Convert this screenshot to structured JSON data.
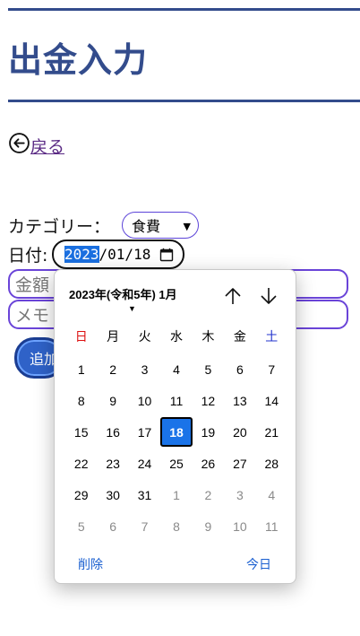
{
  "page": {
    "title": "出金入力"
  },
  "nav": {
    "back_label": "戻る"
  },
  "form": {
    "category_label": "カテゴリー：",
    "category_value": "食費",
    "date_label": "日付:",
    "date_year": "2023",
    "date_rest": "/01/18",
    "amount_placeholder": "金額",
    "memo_placeholder": "メモ",
    "add_label": "追加"
  },
  "datepicker": {
    "month_label": "2023年(令和5年) 1月",
    "weekdays": [
      "日",
      "月",
      "火",
      "水",
      "木",
      "金",
      "土"
    ],
    "days": [
      {
        "d": "1",
        "m": "cur"
      },
      {
        "d": "2",
        "m": "cur"
      },
      {
        "d": "3",
        "m": "cur"
      },
      {
        "d": "4",
        "m": "cur"
      },
      {
        "d": "5",
        "m": "cur"
      },
      {
        "d": "6",
        "m": "cur"
      },
      {
        "d": "7",
        "m": "cur"
      },
      {
        "d": "8",
        "m": "cur"
      },
      {
        "d": "9",
        "m": "cur"
      },
      {
        "d": "10",
        "m": "cur"
      },
      {
        "d": "11",
        "m": "cur"
      },
      {
        "d": "12",
        "m": "cur"
      },
      {
        "d": "13",
        "m": "cur"
      },
      {
        "d": "14",
        "m": "cur"
      },
      {
        "d": "15",
        "m": "cur"
      },
      {
        "d": "16",
        "m": "cur"
      },
      {
        "d": "17",
        "m": "cur"
      },
      {
        "d": "18",
        "m": "sel"
      },
      {
        "d": "19",
        "m": "cur"
      },
      {
        "d": "20",
        "m": "cur"
      },
      {
        "d": "21",
        "m": "cur"
      },
      {
        "d": "22",
        "m": "cur"
      },
      {
        "d": "23",
        "m": "cur"
      },
      {
        "d": "24",
        "m": "cur"
      },
      {
        "d": "25",
        "m": "cur"
      },
      {
        "d": "26",
        "m": "cur"
      },
      {
        "d": "27",
        "m": "cur"
      },
      {
        "d": "28",
        "m": "cur"
      },
      {
        "d": "29",
        "m": "cur"
      },
      {
        "d": "30",
        "m": "cur"
      },
      {
        "d": "31",
        "m": "cur"
      },
      {
        "d": "1",
        "m": "other"
      },
      {
        "d": "2",
        "m": "other"
      },
      {
        "d": "3",
        "m": "other"
      },
      {
        "d": "4",
        "m": "other"
      },
      {
        "d": "5",
        "m": "other"
      },
      {
        "d": "6",
        "m": "other"
      },
      {
        "d": "7",
        "m": "other"
      },
      {
        "d": "8",
        "m": "other"
      },
      {
        "d": "9",
        "m": "other"
      },
      {
        "d": "10",
        "m": "other"
      },
      {
        "d": "11",
        "m": "other"
      }
    ],
    "clear_label": "削除",
    "today_label": "今日"
  },
  "colors": {
    "accent": "#334c8c",
    "field_border": "#6a44d8",
    "selected": "#1a73e8"
  }
}
